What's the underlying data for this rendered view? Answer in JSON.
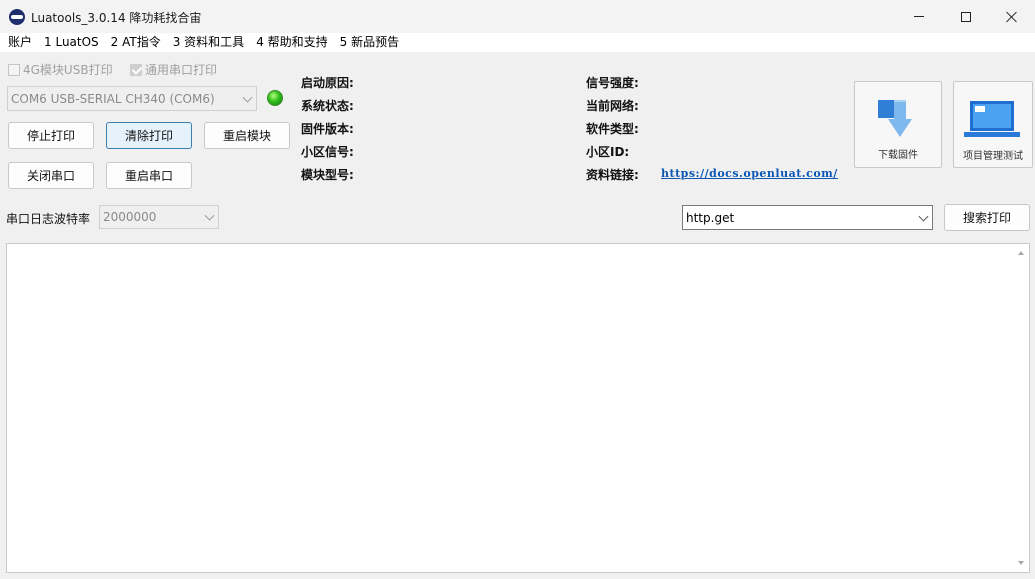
{
  "window": {
    "title": "Luatools_3.0.14 降功耗找合宙"
  },
  "menu": [
    {
      "label": "账户"
    },
    {
      "label": "1 LuatOS"
    },
    {
      "label": "2 AT指令"
    },
    {
      "label": "3 资料和工具"
    },
    {
      "label": "4 帮助和支持"
    },
    {
      "label": "5 新品预告"
    }
  ],
  "options": {
    "usb_print_label": "4G模块USB打印",
    "usb_print_checked": false,
    "serial_print_label": "通用串口打印",
    "serial_print_checked": true
  },
  "port": {
    "selected": "COM6 USB-SERIAL CH340 (COM6)",
    "status_color": "#2fbf1d"
  },
  "buttons": {
    "stop_print": "停止打印",
    "clear_print": "清除打印",
    "restart_module": "重启模块",
    "close_port": "关闭串口",
    "restart_port": "重启串口",
    "search_print": "搜索打印"
  },
  "info": {
    "boot_reason": "启动原因:",
    "system_state": "系统状态:",
    "firmware_version": "固件版本:",
    "cell_signal": "小区信号:",
    "module_model": "模块型号:",
    "signal_strength": "信号强度:",
    "current_network": "当前网络:",
    "software_type": "软件类型:",
    "cell_id": "小区ID:",
    "docs_link_label": "资料链接:",
    "docs_link_url": "https://docs.openluat.com/"
  },
  "tools": {
    "download_firmware": "下载固件",
    "project_manager": "项目管理测试"
  },
  "baud": {
    "label": "串口日志波特率",
    "value": "2000000"
  },
  "search": {
    "value": "http.get"
  },
  "colors": {
    "focus_button": "#e5f1fb",
    "link": "#0a57b5",
    "download_arrow": "#4a9be0"
  }
}
